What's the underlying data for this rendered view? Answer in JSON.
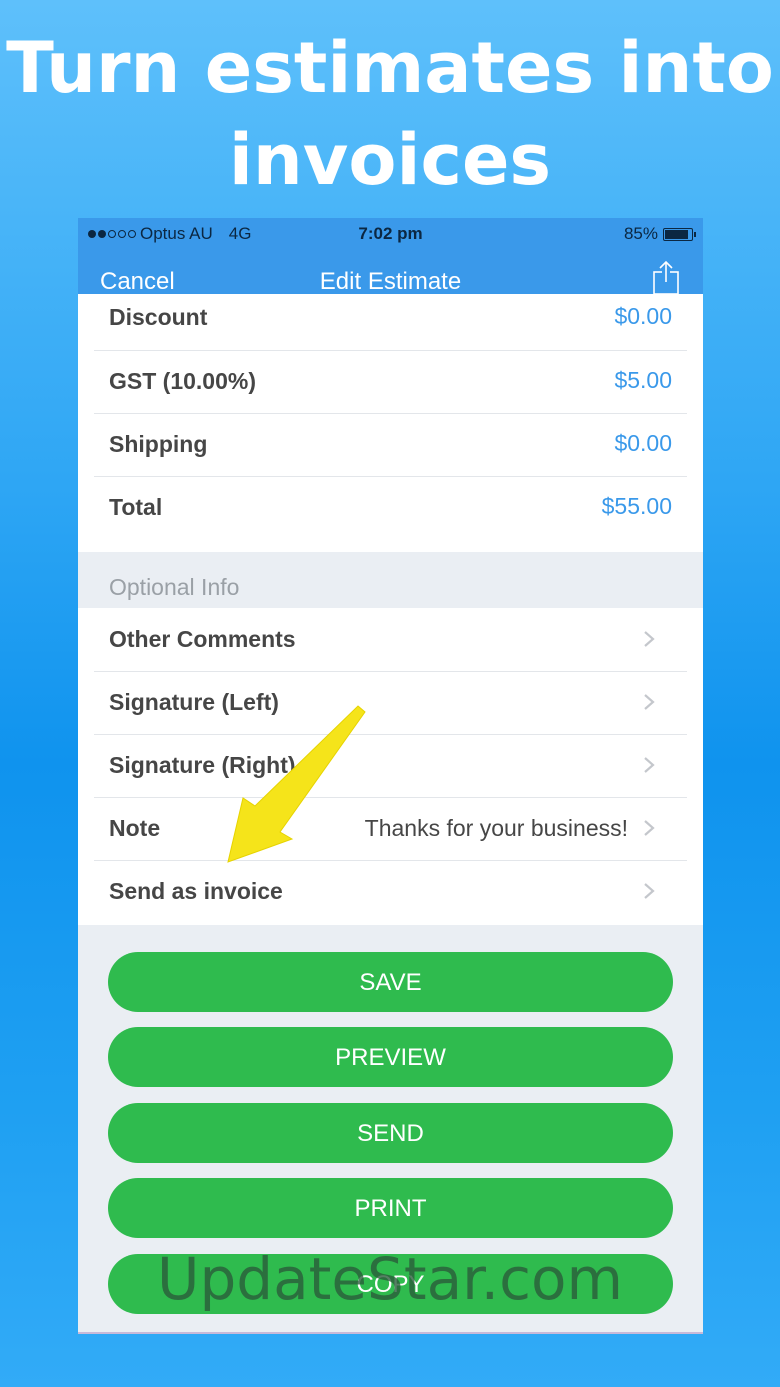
{
  "headline": {
    "line1": "Turn estimates into",
    "line2": "invoices"
  },
  "status_bar": {
    "carrier": "Optus AU",
    "network": "4G",
    "time": "7:02 pm",
    "battery": "85%"
  },
  "nav": {
    "cancel": "Cancel",
    "title": "Edit Estimate",
    "share_icon": "share-icon"
  },
  "totals": [
    {
      "label": "Discount",
      "value": "$0.00"
    },
    {
      "label": "GST (10.00%)",
      "value": "$5.00"
    },
    {
      "label": "Shipping",
      "value": "$0.00"
    },
    {
      "label": "Total",
      "value": "$55.00"
    }
  ],
  "optional": {
    "header": "Optional Info",
    "items": [
      {
        "label": "Other Comments",
        "detail": ""
      },
      {
        "label": "Signature (Left)",
        "detail": ""
      },
      {
        "label": "Signature (Right)",
        "detail": ""
      },
      {
        "label": "Note",
        "detail": "Thanks for your business!"
      },
      {
        "label": "Send as invoice",
        "detail": ""
      }
    ]
  },
  "buttons": {
    "save": "SAVE",
    "preview": "PREVIEW",
    "send": "SEND",
    "print": "PRINT",
    "copy": "COPY"
  },
  "watermark": "UpdateStar.com",
  "colors": {
    "accent": "#3a99ea",
    "button": "#2fbb4e",
    "arrow": "#f5e41a"
  }
}
